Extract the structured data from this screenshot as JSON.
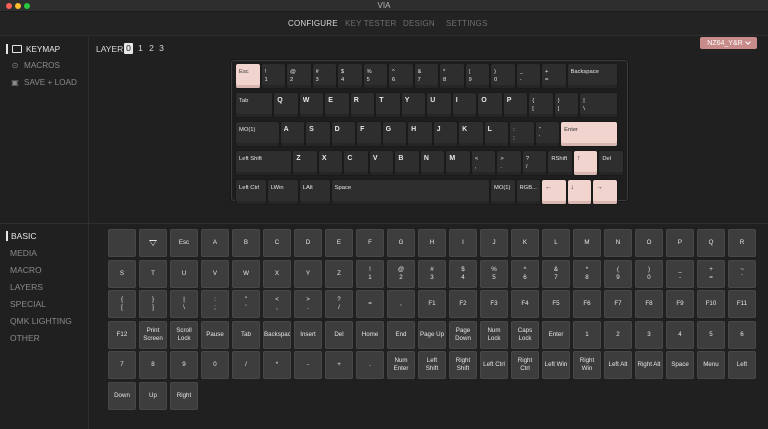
{
  "app": {
    "title": "VIA"
  },
  "nav": {
    "tabs": [
      "CONFIGURE",
      "KEY TESTER",
      "DESIGN",
      "SETTINGS"
    ],
    "active": 0
  },
  "sidebar": {
    "items": [
      "KEYMAP",
      "MACROS",
      "SAVE + LOAD"
    ]
  },
  "layers": {
    "label": "LAYER",
    "values": [
      "0",
      "1",
      "2",
      "3"
    ],
    "active": 0
  },
  "keyboard_select": {
    "value": "NZ64_Y&R"
  },
  "categories": {
    "items": [
      "BASIC",
      "MEDIA",
      "MACRO",
      "LAYERS",
      "SPECIAL",
      "QMK LIGHTING",
      "OTHER"
    ],
    "active": 0
  },
  "colors": {
    "accent_pink": "#f2d4cf",
    "select_bg": "#c98a8a",
    "key_dark": "#2e2e2e",
    "palette_key": "#3d3d3d"
  },
  "keyboard": {
    "rows": [
      [
        "Esc",
        "!\n1",
        "@\n2",
        "#\n3",
        "$\n4",
        "%\n5",
        "^\n6",
        "&\n7",
        "*\n8",
        "(\n9",
        ")\n0",
        "_\n-",
        "+\n=",
        "Backspace"
      ],
      [
        "Tab",
        "Q",
        "W",
        "E",
        "R",
        "T",
        "Y",
        "U",
        "I",
        "O",
        "P",
        "{\n[",
        "}\n]",
        "|\n\\"
      ],
      [
        "MO(1)",
        "A",
        "S",
        "D",
        "F",
        "G",
        "H",
        "J",
        "K",
        "L",
        ":\n;",
        "\"\n'",
        "Enter"
      ],
      [
        "Left Shift",
        "Z",
        "X",
        "C",
        "V",
        "B",
        "N",
        "M",
        "<\n,",
        ">\n.",
        "?\n/",
        "RShift",
        "↑",
        "Del"
      ],
      [
        "Left Ctrl",
        "LWin",
        "LAlt",
        "Space",
        "MO(1)",
        "RGB...",
        "←",
        "↓",
        "→"
      ]
    ]
  },
  "palette": {
    "rows": [
      [
        "",
        "",
        "Esc",
        "A",
        "B",
        "C",
        "D",
        "E",
        "F",
        "G",
        "H",
        "I",
        "J",
        "K",
        "L",
        "M",
        "N",
        "O",
        "P",
        "Q",
        "R"
      ],
      [
        "S",
        "T",
        "U",
        "V",
        "W",
        "X",
        "Y",
        "Z",
        "!\n1",
        "@\n2",
        "#\n3",
        "$\n4",
        "%\n5",
        "^\n6",
        "&\n7",
        "*\n8",
        "(\n9",
        ")\n0",
        "_\n-",
        "+\n=",
        "~\n`"
      ],
      [
        "{\n[",
        "}\n]",
        "|\n\\",
        ":\n;",
        "\"\n'",
        "<\n,",
        ">\n.",
        "?\n/",
        "=",
        ",",
        "F1",
        "F2",
        "F3",
        "F4",
        "F5",
        "F6",
        "F7",
        "F8",
        "F9",
        "F10",
        "F11"
      ],
      [
        "F12",
        "Print\nScreen",
        "Scroll\nLock",
        "Pause",
        "Tab",
        "Backspace",
        "Insert",
        "Del",
        "Home",
        "End",
        "Page Up",
        "Page\nDown",
        "Num\nLock",
        "Caps\nLock",
        "Enter",
        "1",
        "2",
        "3",
        "4",
        "5",
        "6"
      ],
      [
        "7",
        "8",
        "9",
        "0",
        "/",
        "*",
        "-",
        "+",
        ".",
        "Num\nEnter",
        "Left\nShift",
        "Right\nShift",
        "Left Ctrl",
        "Right\nCtrl",
        "Left Win",
        "Right\nWin",
        "Left Alt",
        "Right Alt",
        "Space",
        "Menu",
        "Left"
      ],
      [
        "Down",
        "Up",
        "Right"
      ]
    ]
  }
}
